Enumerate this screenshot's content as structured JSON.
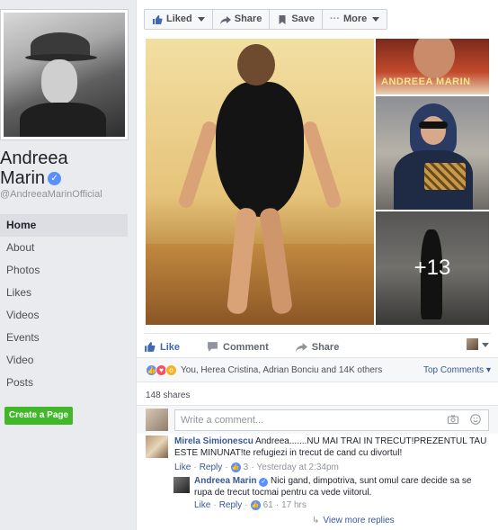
{
  "page": {
    "name_line1": "Andreea",
    "name_line2": "Marin",
    "handle": "@AndreeaMarinOfficial"
  },
  "nav": {
    "items": [
      "Home",
      "About",
      "Photos",
      "Likes",
      "Videos",
      "Events",
      "Video",
      "Posts"
    ],
    "active": "Home",
    "create_page": "Create a Page"
  },
  "action_bar": {
    "liked": "Liked",
    "share": "Share",
    "save": "Save",
    "more": "More"
  },
  "photos": {
    "thumb1_text": "ANDREEA MARIN",
    "more_count": "+13"
  },
  "post_actions": {
    "like": "Like",
    "comment": "Comment",
    "share": "Share"
  },
  "reactions": {
    "summary": "You, Herea Cristina, Adrian Bonciu and 14K others",
    "top_comments": "Top Comments"
  },
  "shares": "148 shares",
  "comment_box": {
    "placeholder": "Write a comment..."
  },
  "comments": [
    {
      "author": "Mirela Simionescu",
      "text": "Andreea.......NU MAI TRAI IN TRECUT!PREZENTUL TAU ESTE MINUNAT!te refugiezi in trecut de cand cu divortul!",
      "like": "Like",
      "reply": "Reply",
      "likes": "3",
      "time": "Yesterday at 2:34pm"
    }
  ],
  "replies": [
    {
      "author": "Andreea Marin",
      "text": "Nici gand, dimpotriva, sunt omul care decide sa se rupa de trecut tocmai pentru ca vede viitorul.",
      "like": "Like",
      "reply": "Reply",
      "likes": "61",
      "time": "17 hrs"
    }
  ],
  "view_more_replies": "View more replies",
  "colors": {
    "facebook_blue": "#4267b2",
    "link": "#385898",
    "create_green": "#42b72a",
    "verified": "#5890ff"
  }
}
